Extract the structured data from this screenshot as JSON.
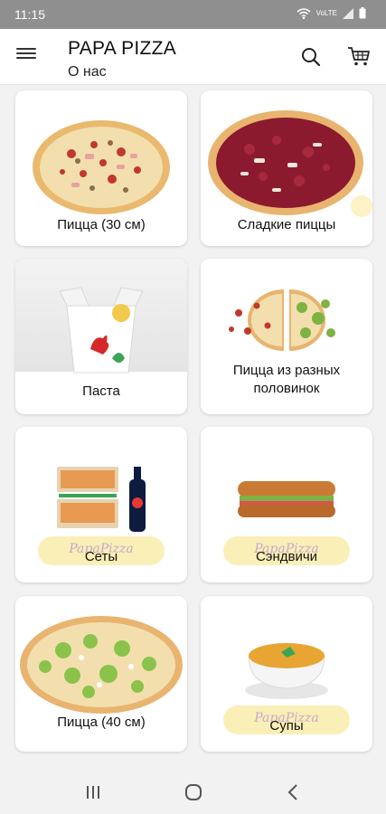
{
  "status_bar": {
    "time": "11:15",
    "network": "VoLTE"
  },
  "app_bar": {
    "title": "PAPA PIZZA",
    "subtitle": "О нас",
    "menu_icon": "hamburger-menu-icon",
    "search_icon": "search-icon",
    "cart_icon": "cart-icon"
  },
  "categories": [
    {
      "label": "Пицца (30 см)",
      "image": "pizza-image"
    },
    {
      "label": "Сладкие пиццы",
      "image": "sweet-pizza-image"
    },
    {
      "label": "Паста",
      "image": "pasta-box-image"
    },
    {
      "label": "Пицца из разных половинок",
      "image": "half-half-pizza-image"
    },
    {
      "label": "Сеты",
      "image": "pizza-set-image"
    },
    {
      "label": "Сэндвичи",
      "image": "sandwich-image"
    },
    {
      "label": "Пицца (40 см)",
      "image": "large-pizza-image"
    },
    {
      "label": "Супы",
      "image": "soup-image"
    }
  ],
  "watermark": "PapaPizza",
  "nav_bar": {
    "recents_icon": "recents-icon",
    "home_icon": "home-icon",
    "back_icon": "back-icon"
  },
  "colors": {
    "status_bar": "#8f8f8f",
    "watermark_bg": "#fbefb8",
    "background": "#f2f2f2"
  }
}
